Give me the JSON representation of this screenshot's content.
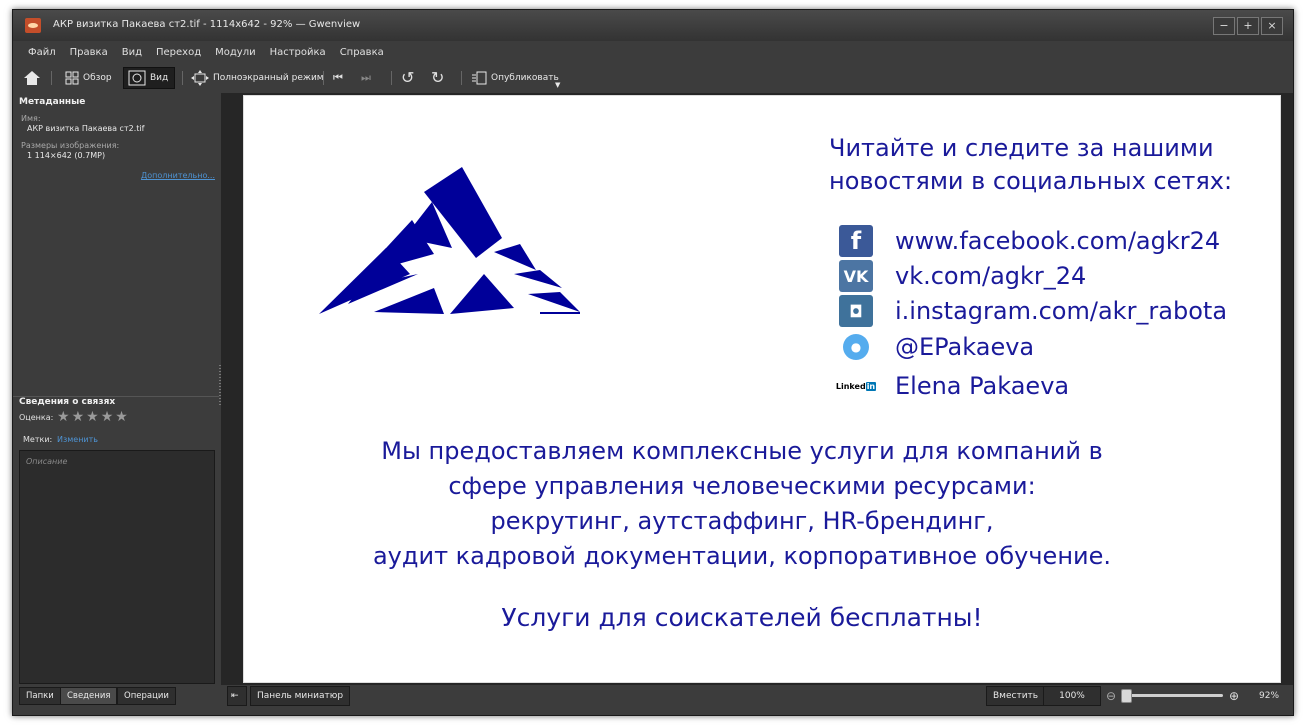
{
  "window": {
    "title": "АКР визитка Пакаева ст2.tif - 1114x642 - 92% — Gwenview",
    "controls": {
      "minimize": "−",
      "maximize": "+",
      "close": "×"
    }
  },
  "menu": [
    "Файл",
    "Правка",
    "Вид",
    "Переход",
    "Модули",
    "Настройка",
    "Справка"
  ],
  "toolbar": {
    "browse_label": "Обзор",
    "view_label": "Вид",
    "fullscreen_label": "Полноэкранный режим",
    "publish_label": "Опубликовать"
  },
  "sidebar": {
    "metadata_title": "Метаданные",
    "name_label": "Имя:",
    "name_value": "АКР визитка Пакаева ст2.tif",
    "size_label": "Размеры изображения:",
    "size_value": "1 114×642 (0.7MP)",
    "more_link": "Дополнительно...",
    "semantic_title": "Сведения о связях",
    "rating_label": "Оценка:",
    "rating_value": 0,
    "rating_max": 5,
    "tags_label": "Метки:",
    "tags_link": "Изменить",
    "description_placeholder": "Описание",
    "tabs": [
      "Папки",
      "Сведения",
      "Операции"
    ],
    "active_tab": "Сведения"
  },
  "image": {
    "heading_line1": "Читайте и следите за нашими",
    "heading_line2": "новостями в социальных сетях:",
    "social": [
      {
        "icon": "facebook-icon",
        "badge": "f",
        "color": "#3b5998",
        "text": "www.facebook.com/agkr24"
      },
      {
        "icon": "vk-icon",
        "badge": "VK",
        "color": "#4c75a3",
        "text": "vk.com/agkr_24"
      },
      {
        "icon": "instagram-icon",
        "badge": "◘",
        "color": "#3f729b",
        "text": "i.instagram.com/akr_rabota"
      },
      {
        "icon": "twitter-icon",
        "badge": "●",
        "color": "#55acee",
        "text": "@EPakaeva"
      },
      {
        "icon": "linkedin-icon",
        "badge": "Linked",
        "badge2": "in",
        "color": "#0077b5",
        "text": "Elena Pakaeva"
      }
    ],
    "services_line1": "Мы предоставляем комплексные услуги для компаний в",
    "services_line2": "сфере управления человеческими ресурсами:",
    "services_line3": "рекрутинг, аутстаффинг, HR-брендинг,",
    "services_line4": "аудит кадровой документации, корпоративное обучение.",
    "free_line": "Услуги для соискателей бесплатны!",
    "text_color": "#1a1a9a",
    "logo_color": "#000099"
  },
  "statusbar": {
    "thumbnail_panel_label": "Панель миниатюр",
    "fit_label": "Вместить",
    "zoom_100_label": "100%",
    "zoom_percent": "92%",
    "zoom_value": 0.92
  }
}
